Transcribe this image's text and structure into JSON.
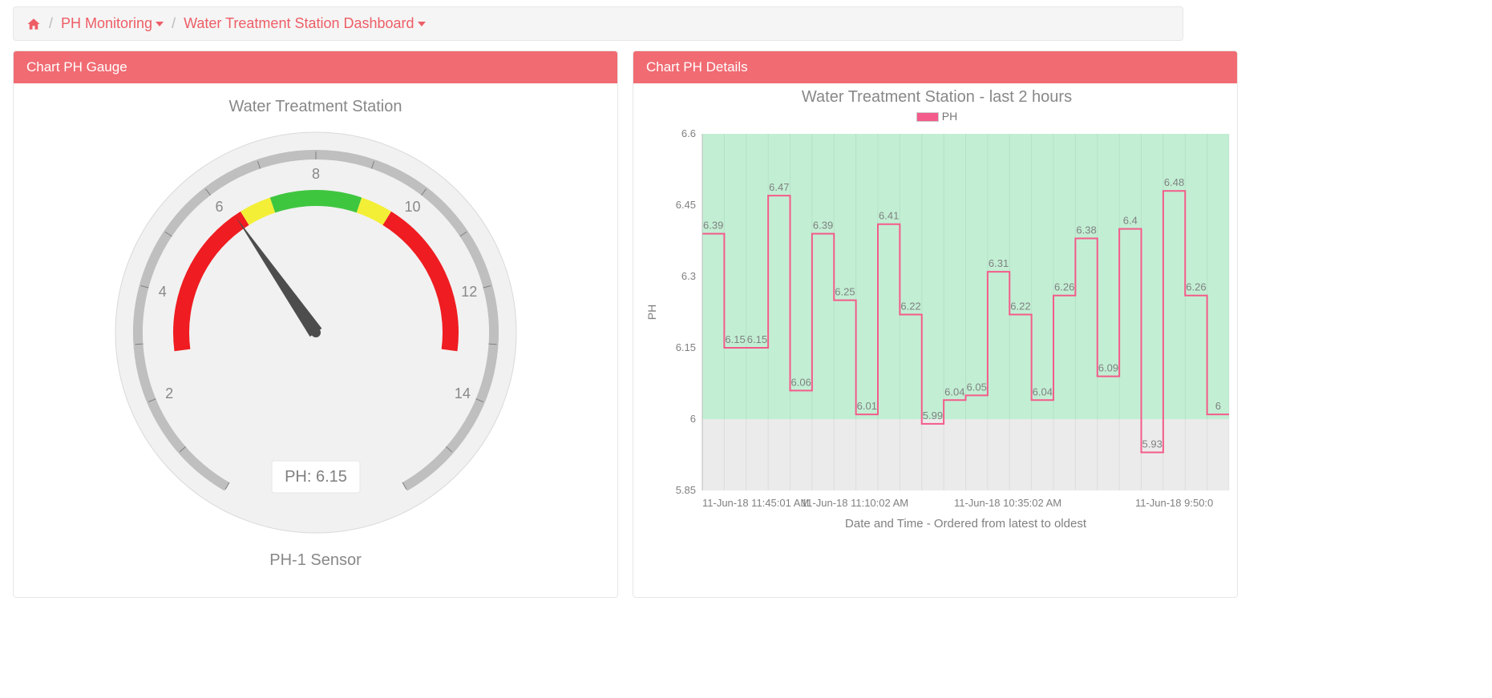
{
  "breadcrumb": {
    "items": [
      {
        "label": "PH Monitoring",
        "dropdown": true
      },
      {
        "label": "Water Treatment Station Dashboard",
        "dropdown": true
      }
    ]
  },
  "panels": {
    "gauge": {
      "header": "Chart PH Gauge",
      "title": "Water Treatment Station",
      "subtitle": "PH-1 Sensor",
      "value_label": "PH: 6.15",
      "axis": {
        "min": 0,
        "max": 16,
        "ticks": [
          2,
          4,
          6,
          8,
          10,
          12,
          14
        ]
      }
    },
    "details": {
      "header": "Chart PH Details",
      "title": "Water Treatment Station - last 2 hours",
      "legend": "PH",
      "xlabel": "Date and Time - Ordered from latest to oldest",
      "ylabel": "PH"
    }
  },
  "chart_data": {
    "gauge": {
      "type": "gauge",
      "value": 6.15,
      "min": 0,
      "max": 16,
      "ticks": [
        2,
        4,
        6,
        8,
        10,
        12,
        14
      ],
      "bands": [
        {
          "from": 2.8,
          "to": 6.3,
          "color": "#ef1c21"
        },
        {
          "from": 6.3,
          "to": 7.0,
          "color": "#f3ef36"
        },
        {
          "from": 7.0,
          "to": 9.0,
          "color": "#3fc63f"
        },
        {
          "from": 9.0,
          "to": 9.7,
          "color": "#f3ef36"
        },
        {
          "from": 9.7,
          "to": 13.2,
          "color": "#ef1c21"
        }
      ],
      "title": "Water Treatment Station",
      "subtitle": "PH-1 Sensor",
      "value_label": "PH: 6.15"
    },
    "line": {
      "type": "line",
      "step": true,
      "series": [
        {
          "name": "PH",
          "color": "#f45b8a",
          "values": [
            6.39,
            6.15,
            6.15,
            6.47,
            6.06,
            6.39,
            6.25,
            6.01,
            6.41,
            6.22,
            5.99,
            6.04,
            6.05,
            6.31,
            6.22,
            6.04,
            6.26,
            6.38,
            6.09,
            6.4,
            5.93,
            6.48,
            6.26,
            6.01
          ]
        }
      ],
      "ylim": [
        5.85,
        6.6
      ],
      "yticks": [
        5.85,
        6,
        6.15,
        6.3,
        6.45,
        6.6
      ],
      "ylabel": "PH",
      "xlabel": "Date and Time - Ordered from latest to oldest",
      "x_tick_labels": [
        "11-Jun-18 11:45:01 AM",
        "11-Jun-18 11:10:02 AM",
        "11-Jun-18 10:35:02 AM",
        "11-Jun-18 9:50:0"
      ],
      "title": "Water Treatment Station - last 2 hours",
      "green_band": {
        "from": 6.0,
        "to": 6.6
      },
      "legend": [
        "PH"
      ]
    }
  }
}
